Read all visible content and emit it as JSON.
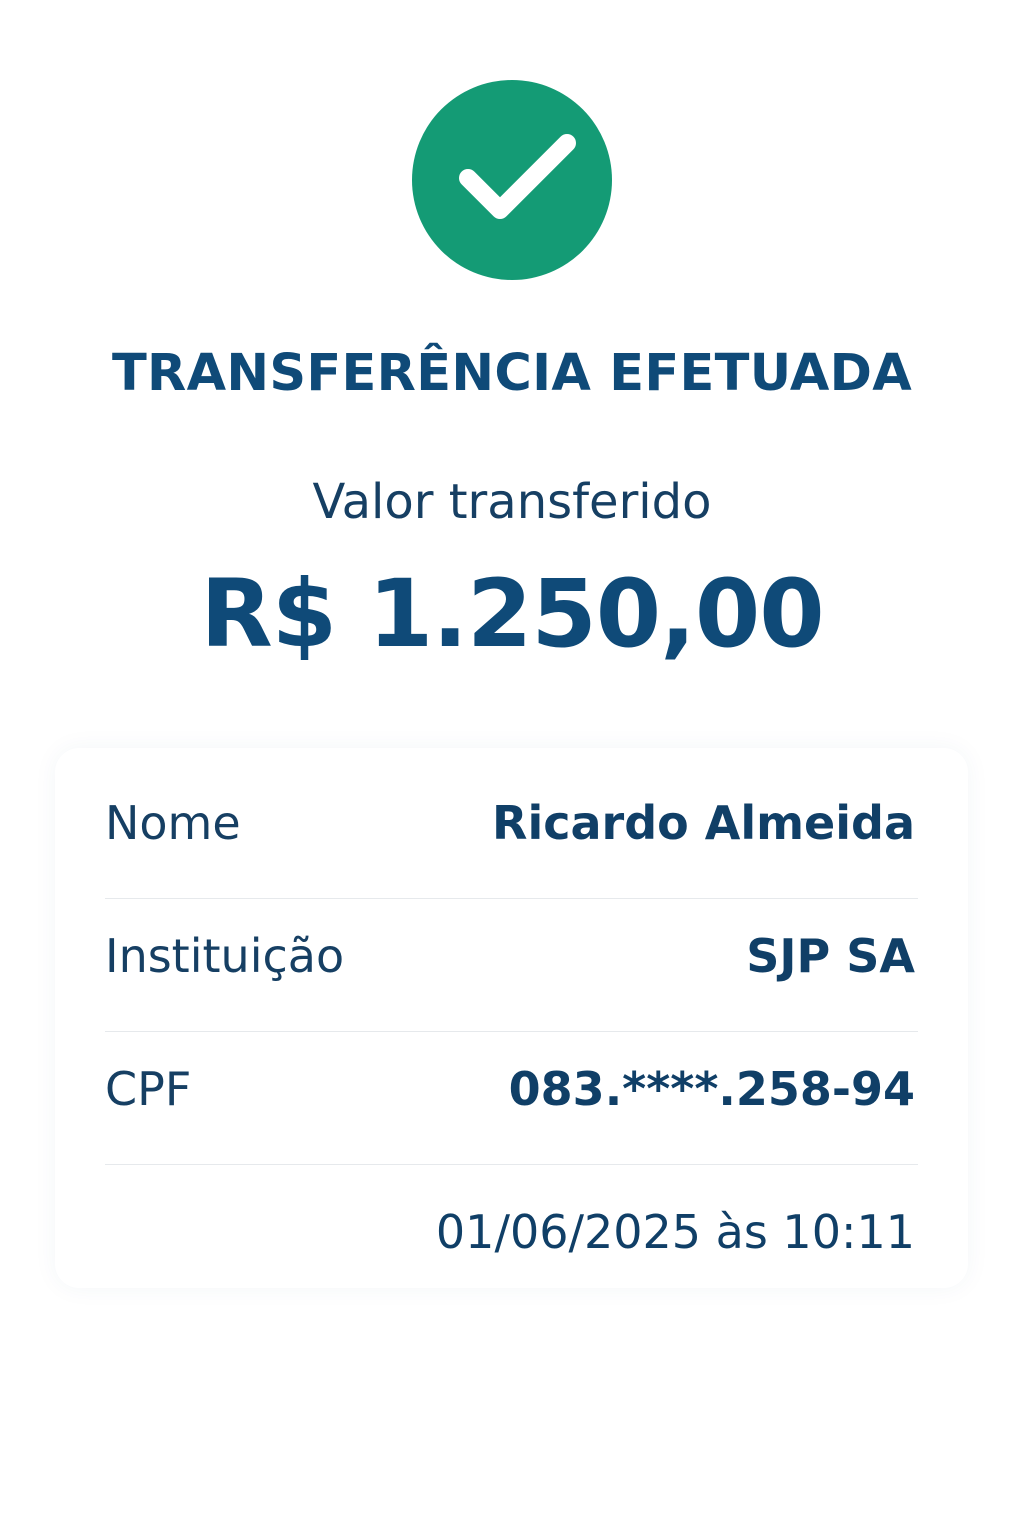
{
  "status": {
    "icon": "check-circle-icon",
    "color": "#149b75",
    "title": "TRANSFERÊNCIA EFETUADA"
  },
  "amount": {
    "label": "Valor transferido",
    "value": "R$ 1.250,00"
  },
  "details": {
    "rows": [
      {
        "label": "Nome",
        "value": "Ricardo Almeida"
      },
      {
        "label": "Instituição",
        "value": "SJP SA"
      },
      {
        "label": "CPF",
        "value": "083.****.258-94"
      }
    ],
    "datetime": "01/06/2025 às 10:11"
  },
  "colors": {
    "primary_text": "#0f4a78",
    "success": "#149b75",
    "divider": "#e6e9ec"
  }
}
